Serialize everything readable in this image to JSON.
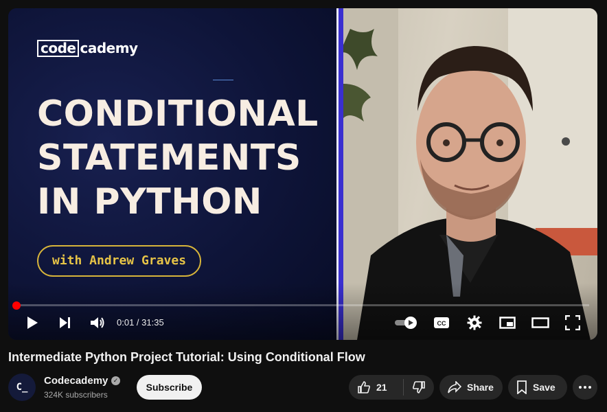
{
  "player": {
    "thumbnail": {
      "logo_text_boxed": "code",
      "logo_text_rest": "cademy",
      "title_lines": [
        "CONDITIONAL",
        "STATEMENTS",
        "IN PYTHON"
      ],
      "presenter_pill": "with Andrew Graves",
      "accent_color": "#3a2fd0",
      "pill_color": "#e7c447"
    },
    "progress_fraction": 0.0005,
    "time_display": "0:01 / 31:35",
    "controls": {
      "play_icon": "play-icon",
      "next_icon": "next-icon",
      "volume_icon": "volume-icon",
      "autoplay_icon": "autoplay-toggle-icon",
      "captions_label": "CC",
      "settings_icon": "gear-icon",
      "miniplayer_icon": "miniplayer-icon",
      "theater_icon": "theater-icon",
      "fullscreen_icon": "fullscreen-icon"
    }
  },
  "video": {
    "title": "Intermediate Python Project Tutorial: Using Conditional Flow"
  },
  "channel": {
    "name": "Codecademy",
    "subscribers": "324K subscribers",
    "avatar_text": "C_",
    "subscribe_label": "Subscribe"
  },
  "actions": {
    "like_count": "21",
    "share_label": "Share",
    "save_label": "Save"
  }
}
